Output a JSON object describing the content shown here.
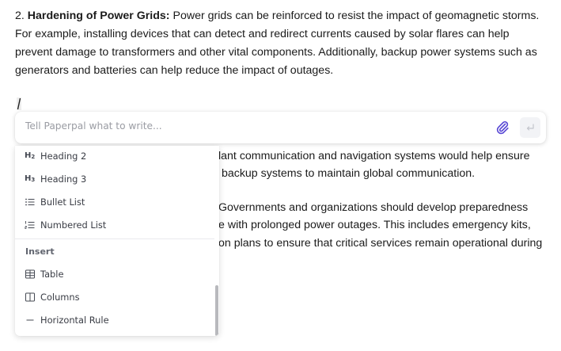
{
  "document": {
    "paragraph": {
      "number": "2.",
      "bold_title": "Hardening of Power Grids:",
      "line1_rest": "Power grids can be reinforced to resist the impact of geomagnetic storms.",
      "line2": "For example, installing devices that can detect and redirect currents caused by solar flares can help",
      "line3": "prevent damage to transformers and other vital components. Additionally, backup power systems such as",
      "line4": "generators and batteries can help reduce the impact of outages."
    },
    "partially_hidden_lines": [
      "lant communication and navigation systems would help ensure",
      " backup systems to maintain global communication.",
      "Governments and organizations should develop preparedness",
      "e with prolonged power outages. This includes emergency kits,",
      "on plans to ensure that critical services remain operational during"
    ]
  },
  "prompt": {
    "placeholder": "Tell Paperpal what to write...",
    "attach_icon": "paperclip-icon",
    "submit_icon": "return-arrow-icon"
  },
  "menu": {
    "items_top": [
      {
        "icon": "heading-2-icon",
        "icon_text": "H",
        "icon_sub": "2",
        "label": "Heading 2"
      },
      {
        "icon": "heading-3-icon",
        "icon_text": "H",
        "icon_sub": "3",
        "label": "Heading 3"
      },
      {
        "icon": "bullet-list-icon",
        "label": "Bullet List"
      },
      {
        "icon": "numbered-list-icon",
        "label": "Numbered List"
      }
    ],
    "section_heading": "Insert",
    "items_insert": [
      {
        "icon": "table-icon",
        "label": "Table"
      },
      {
        "icon": "columns-icon",
        "label": "Columns"
      },
      {
        "icon": "horizontal-rule-icon",
        "label": "Horizontal Rule"
      }
    ]
  },
  "colors": {
    "accent": "#5b4bd5",
    "text": "#1b1b1b",
    "placeholder": "#9a9ca3"
  }
}
